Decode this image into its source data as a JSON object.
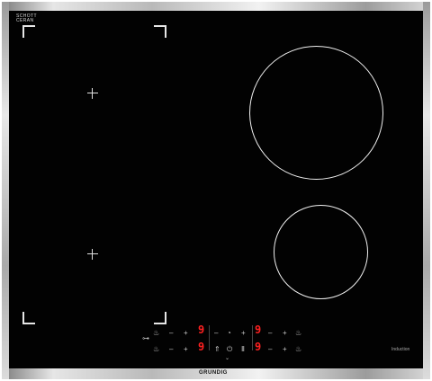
{
  "hob": {
    "brand_logo": [
      "SCHOTT",
      "CERAN"
    ],
    "model_logo": "GRUNDIG",
    "induction_label": "Induction"
  },
  "control_panel": {
    "left_zone_top": {
      "minus": "–",
      "plus": "+",
      "digit": "9",
      "icon": "pan-icon"
    },
    "left_zone_bottom": {
      "minus": "–",
      "plus": "+",
      "digit": "9",
      "icon": "pan-icon"
    },
    "center_top": {
      "minus": "–",
      "plus": "+",
      "icon": "timer-icon"
    },
    "center_bottom": {
      "minus": "–",
      "plus": "+",
      "icon": "power-icon"
    },
    "right_zone_top": {
      "minus": "–",
      "plus": "+",
      "digit": "9",
      "icon": "pan-icon"
    },
    "right_zone_bottom": {
      "minus": "–",
      "plus": "+",
      "digit": "9",
      "icon": "pan-icon"
    },
    "colors": {
      "display": "#ff2020",
      "glass": "#020202",
      "markings": "#f0f0f0"
    }
  }
}
